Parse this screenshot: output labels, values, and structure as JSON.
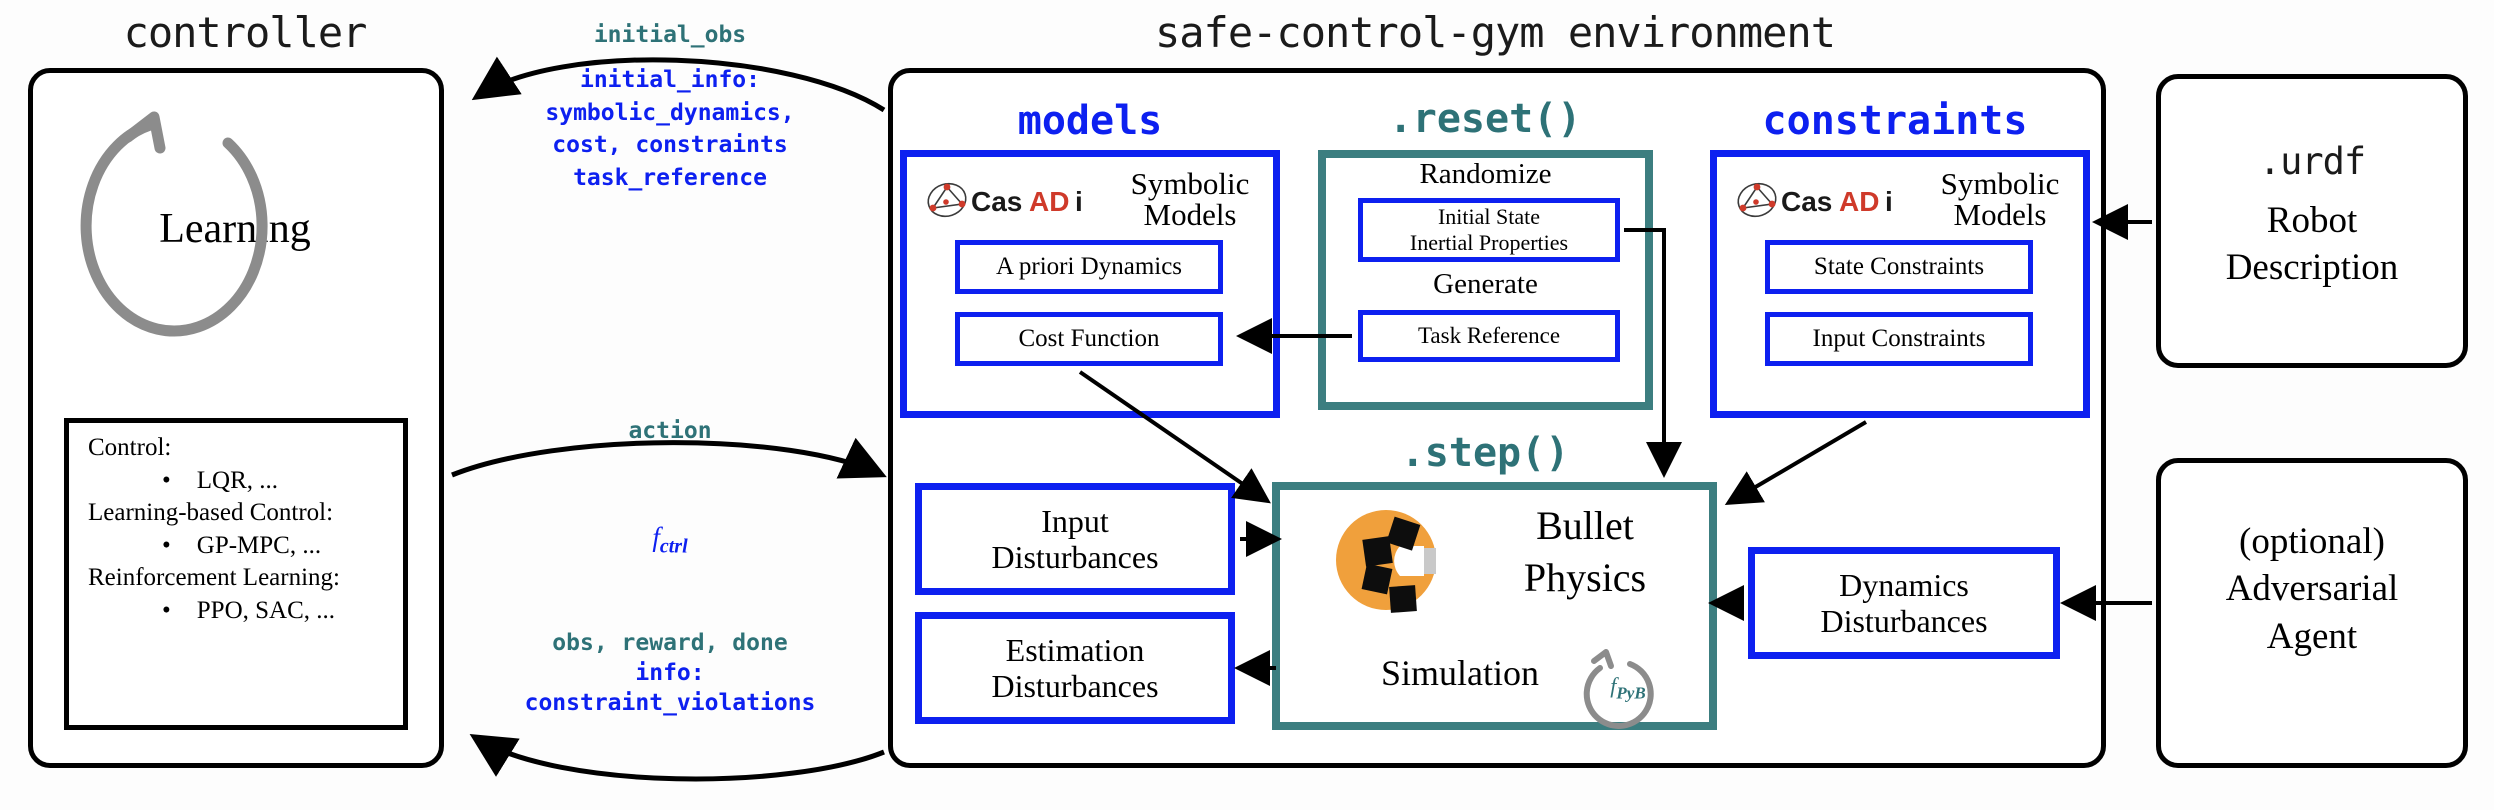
{
  "meta": {
    "colors": {
      "blue": "#0d20f0",
      "teal": "#2e7277",
      "teal_border": "#3c7e80",
      "black": "#000000",
      "gray": "#8c8c8c",
      "orange": "#f0a03c",
      "casadi_red": "#cf3a2a"
    }
  },
  "headers": {
    "controller": "controller",
    "environment": "safe-control-gym environment"
  },
  "controller": {
    "loop_label": "Learning",
    "loop_icon": "circular-arrow-icon",
    "methods": [
      {
        "heading": "Control:",
        "item": "LQR,  ..."
      },
      {
        "heading": "Learning-based  Control:",
        "item": "GP-MPC,  ..."
      },
      {
        "heading": "Reinforcement  Learning:",
        "item": "PPO,  SAC,  ..."
      }
    ]
  },
  "arrows": {
    "top": {
      "label_teal": "initial_obs",
      "label_blue_lines": [
        "initial_info:",
        "symbolic_dynamics,",
        "cost, constraints",
        "task_reference"
      ]
    },
    "middle": {
      "label_teal": "action",
      "label_blue_italic": "f",
      "label_blue_italic_sub": "ctrl"
    },
    "bottom": {
      "label_teal": "obs, reward, done",
      "label_blue_lines": [
        "info:",
        "constraint_violations"
      ]
    }
  },
  "env": {
    "models": {
      "title": "models",
      "logo": "casadi-logo",
      "logo_text_parts": [
        "Cas",
        "AD",
        "i"
      ],
      "subtitle_lines": [
        "Symbolic",
        "Models"
      ],
      "boxes": [
        {
          "text_italic_a": "A",
          "text_italic": "priori",
          "text_rest": "Dynamics",
          "full": "A  priori  Dynamics"
        },
        {
          "full": "Cost  Function"
        }
      ]
    },
    "reset": {
      "title": ".reset()",
      "groups": [
        {
          "heading": "Randomize",
          "box_lines": [
            "Initial  State",
            "Inertial  Properties"
          ]
        },
        {
          "heading": "Generate",
          "box_lines": [
            "Task  Reference"
          ]
        }
      ]
    },
    "constraints": {
      "title": "constraints",
      "logo": "casadi-logo",
      "logo_text_parts": [
        "Cas",
        "AD",
        "i"
      ],
      "subtitle_lines": [
        "Symbolic",
        "Models"
      ],
      "boxes": [
        {
          "full": "State  Constraints"
        },
        {
          "full": "Input  Constraints"
        }
      ]
    },
    "step": {
      "title": ".step()",
      "bullet_logo": "bullet-physics-logo",
      "title_lines": [
        "Bullet",
        "Physics"
      ],
      "sim_label": "Simulation",
      "sim_loop_icon": "circular-arrow-icon",
      "sim_loop_label": "f",
      "sim_loop_sub": "PyB"
    },
    "disturbances_left": [
      {
        "lines": [
          "Input",
          "Disturbances"
        ]
      },
      {
        "lines": [
          "Estimation",
          "Disturbances"
        ]
      }
    ],
    "disturbances_right": [
      {
        "lines": [
          "Dynamics",
          "Disturbances"
        ]
      }
    ]
  },
  "external": {
    "urdf": {
      "mono_line": ".urdf",
      "serif_lines": [
        "Robot",
        "Description"
      ]
    },
    "adversary": {
      "serif_lines": [
        "(optional)",
        "Adversarial",
        "Agent"
      ]
    }
  }
}
